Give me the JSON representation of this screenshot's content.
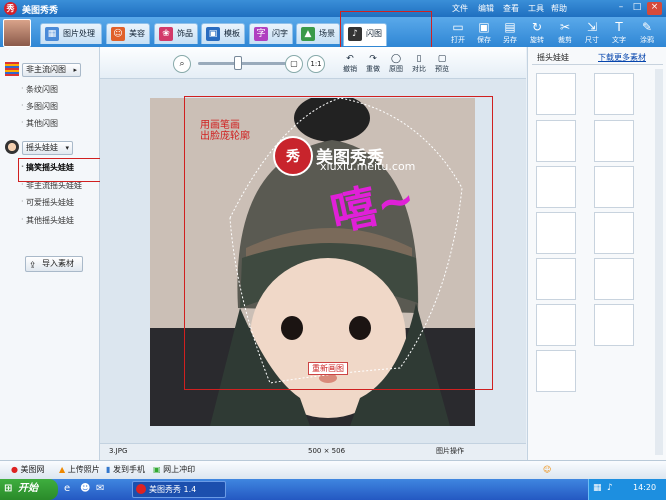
{
  "app": {
    "logo_text": "秀",
    "title": "美图秀秀"
  },
  "menu": [
    "文件",
    "编辑",
    "查看",
    "工具",
    "帮助"
  ],
  "tabs": [
    {
      "label": "图片处理",
      "icon": "image-icon",
      "color": "#4a8ad8"
    },
    {
      "label": "美容",
      "icon": "face-icon",
      "color": "#e0602a"
    },
    {
      "label": "饰品",
      "icon": "ornament-icon",
      "color": "#d23a6a"
    },
    {
      "label": "模板",
      "icon": "template-icon",
      "color": "#2a6cc0"
    },
    {
      "label": "闪字",
      "icon": "text-icon",
      "color": "#b040c0"
    },
    {
      "label": "场景",
      "icon": "scene-icon",
      "color": "#3a9a4a"
    },
    {
      "label": "闪图",
      "icon": "flash-icon",
      "color": "#333333"
    }
  ],
  "tools": [
    {
      "label": "打开",
      "glyph": "▭"
    },
    {
      "label": "保存",
      "glyph": "▣"
    },
    {
      "label": "另存",
      "glyph": "▤"
    },
    {
      "label": "旋转",
      "glyph": "↻"
    },
    {
      "label": "裁剪",
      "glyph": "✂"
    },
    {
      "label": "尺寸",
      "glyph": "⇲"
    },
    {
      "label": "文字",
      "glyph": "T"
    },
    {
      "label": "涂鸦",
      "glyph": "✎"
    }
  ],
  "left": {
    "cat1": "非主流闪图",
    "cat1_items": [
      "条纹闪图",
      "多图闪图",
      "其他闪图"
    ],
    "cat2": "摇头娃娃",
    "cat2_items": [
      "搞笑摇头娃娃",
      "非主流摇头娃娃",
      "可爱摇头娃娃",
      "其他摇头娃娃"
    ],
    "import": "导入素材"
  },
  "canvas_tools": [
    {
      "label": "撤销",
      "glyph": "↶"
    },
    {
      "label": "重做",
      "glyph": "↷"
    },
    {
      "label": "原图",
      "glyph": "◯"
    },
    {
      "label": "对比",
      "glyph": "▯"
    },
    {
      "label": "预览",
      "glyph": "▢"
    }
  ],
  "photo": {
    "hint": "用画笔画\n出脸庞轮廓",
    "watermark": "美图秀秀",
    "url": "xiuxiu.meitu.com",
    "scribble": "嘻~",
    "redraw": "重新画图"
  },
  "status": {
    "filename": "3.JPG",
    "dims": "500 × 506",
    "mode": "图片操作"
  },
  "right": {
    "title": "摇头娃娃",
    "more": "下载更多素材"
  },
  "bottom": [
    "美图网",
    "上传照片",
    "发到手机",
    "网上冲印"
  ],
  "taskbar": {
    "start": "开始",
    "window": "美图秀秀 1.4",
    "clock": "14:20"
  }
}
